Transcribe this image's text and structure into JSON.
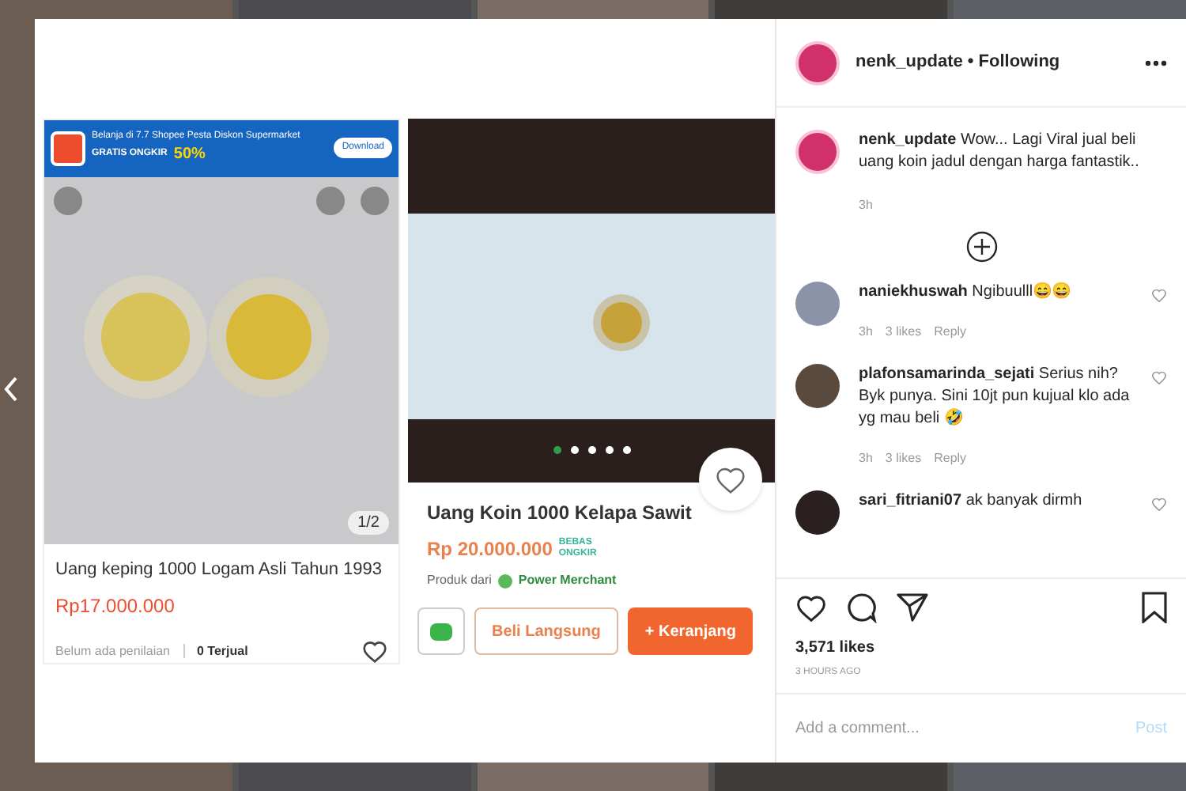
{
  "post_image": {
    "left_listing": {
      "banner": {
        "title": "Belanja di 7.7 Shopee Pesta Diskon Supermarket",
        "promo": "GRATIS ONGKIR",
        "discount": "50%",
        "button": "Download"
      },
      "counter": "1/2",
      "title": "Uang keping 1000 Logam Asli Tahun 1993",
      "price": "Rp17.000.000",
      "rating": "Belum ada penilaian",
      "sold": "0 Terjual"
    },
    "right_listing": {
      "dots": [
        {
          "selected": true
        },
        {
          "selected": false
        },
        {
          "selected": false
        },
        {
          "selected": false
        },
        {
          "selected": false
        }
      ],
      "title": "Uang Koin 1000 Kelapa Sawit",
      "price": "Rp 20.000.000",
      "shipping_badge": "BEBAS ONGKIR",
      "seller_prefix": "Produk dari",
      "seller_badge": "Power Merchant",
      "buttons": [
        {
          "label": "Beli Langsung",
          "kind": "outline"
        },
        {
          "label": "+ Keranjang",
          "kind": "primary"
        }
      ]
    }
  },
  "post": {
    "username": "nenk_update",
    "separator": "•",
    "follow_status": "Following",
    "caption": {
      "username": "nenk_update",
      "text": "Wow... Lagi Viral jual beli uang koin jadul dengan harga fantastik..",
      "time": "3h"
    },
    "comments": [
      {
        "username": "naniekhuswah",
        "text": "Ngibuulll😄😄",
        "time": "3h",
        "likes": "3 likes",
        "reply": "Reply"
      },
      {
        "username": "plafonsamarinda_sejati",
        "text": "Serius nih? Byk punya. Sini 10jt pun kujual klo ada yg mau beli 🤣",
        "time": "3h",
        "likes": "3 likes",
        "reply": "Reply"
      },
      {
        "username": "sari_fitriani07",
        "text": "ak banyak dirmh"
      }
    ],
    "likes": "3,571 likes",
    "time": "3 HOURS AGO",
    "comment_placeholder": "Add a comment...",
    "post_button": "Post"
  }
}
